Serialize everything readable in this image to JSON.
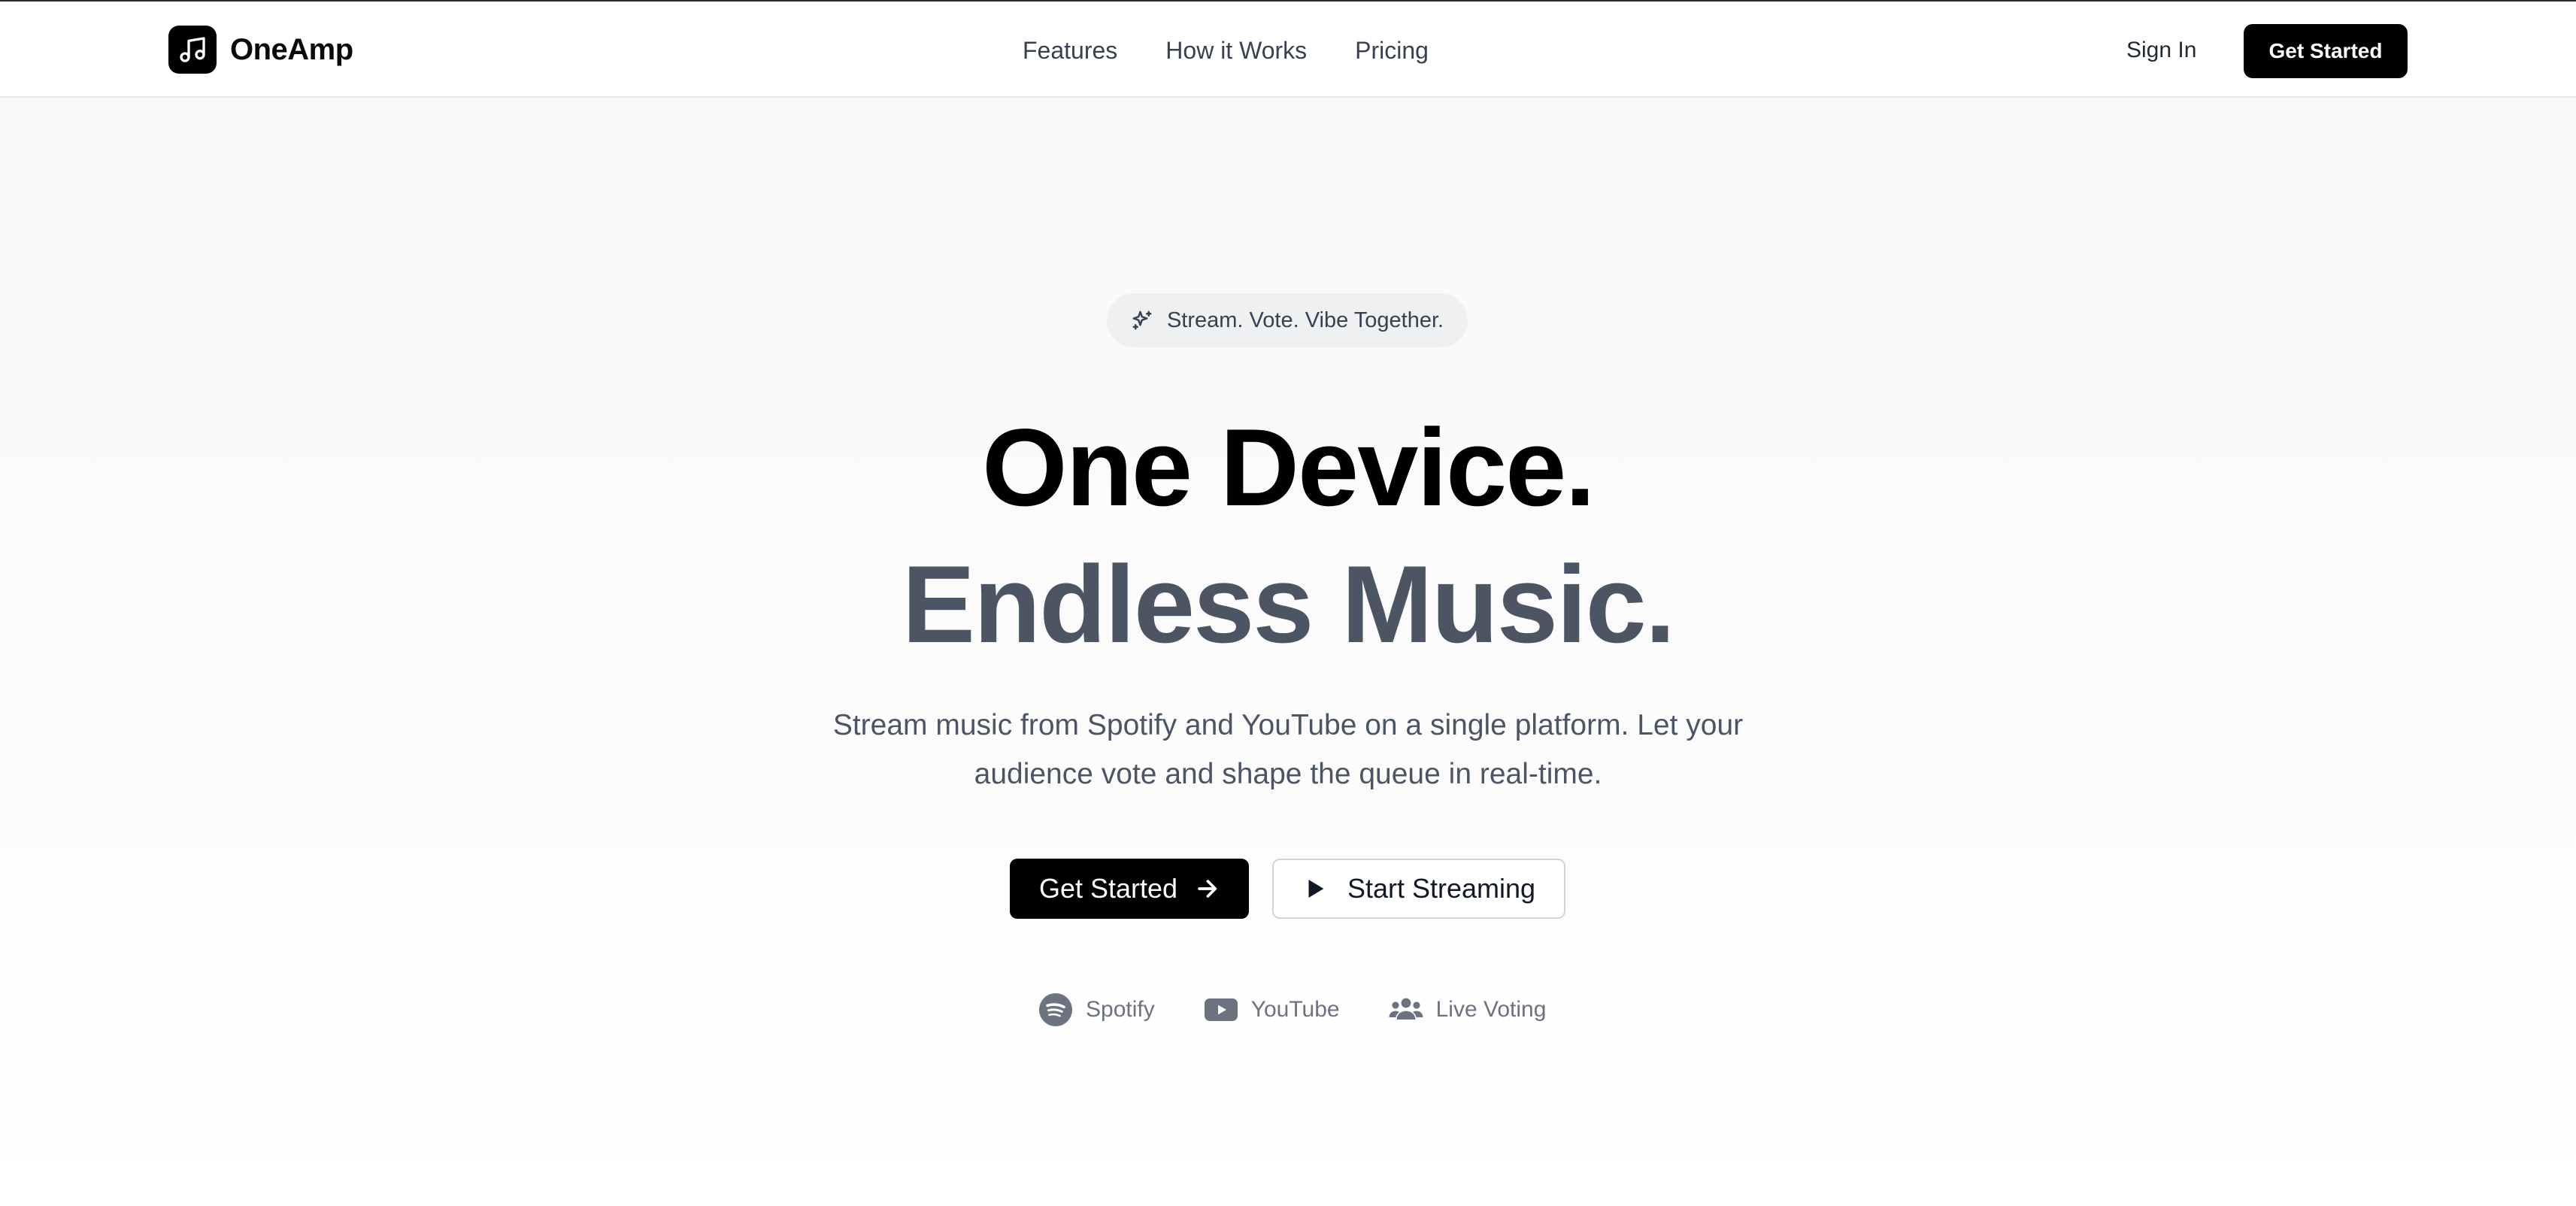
{
  "header": {
    "brand_name": "OneAmp",
    "nav": [
      {
        "label": "Features"
      },
      {
        "label": "How it Works"
      },
      {
        "label": "Pricing"
      }
    ],
    "sign_in_label": "Sign In",
    "get_started_label": "Get Started"
  },
  "hero": {
    "tagline": "Stream. Vote. Vibe Together.",
    "headline_line1": "One Device.",
    "headline_line2": "Endless Music.",
    "description": "Stream music from Spotify and YouTube on a single platform. Let your audience vote and shape the queue in real-time.",
    "primary_cta_label": "Get Started",
    "secondary_cta_label": "Start Streaming",
    "features": [
      {
        "label": "Spotify",
        "icon": "spotify-icon"
      },
      {
        "label": "YouTube",
        "icon": "youtube-icon"
      },
      {
        "label": "Live Voting",
        "icon": "users-icon"
      }
    ]
  },
  "colors": {
    "primary": "#000000",
    "headline_secondary": "#4b5563",
    "muted_text": "#6b7280",
    "pill_background": "#eff0f2"
  }
}
